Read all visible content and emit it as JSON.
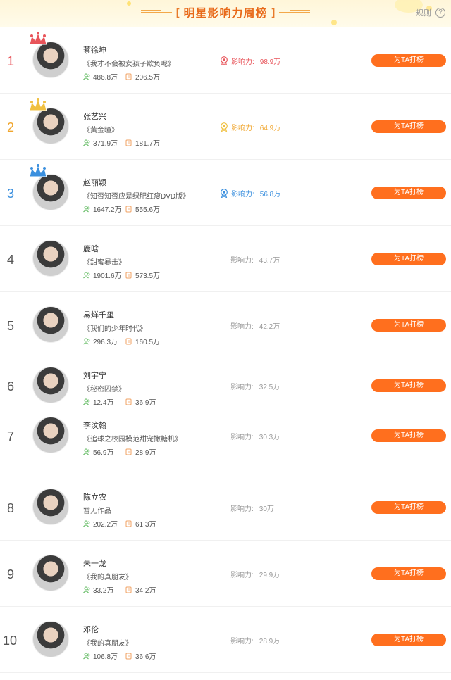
{
  "header": {
    "title": "明星影响力周榜",
    "bracket_left": "[",
    "bracket_right": "]",
    "rule_label": "规则",
    "rule_icon": "question-circle-icon"
  },
  "influence_label": "影响力:",
  "vote_label": "为TA打榜",
  "colors": {
    "accent": "#ff6f1e",
    "rank1": "#e8545a",
    "rank2": "#f0a52c",
    "rank3": "#3a8fde",
    "fans_icon": "#5cb85c",
    "works_icon": "#f0a060"
  },
  "stars": [
    {
      "rank": "1",
      "name": "蔡徐坤",
      "work": "《我才不会被女孩子欺负呢》",
      "fans": "486.8万",
      "count": "206.5万",
      "influence": "98.9万"
    },
    {
      "rank": "2",
      "name": "张艺兴",
      "work": "《黄金瞳》",
      "fans": "371.9万",
      "count": "181.7万",
      "influence": "64.9万"
    },
    {
      "rank": "3",
      "name": "赵丽颖",
      "work": "《知否知否应是绿肥红瘦DVD版》",
      "fans": "1647.2万",
      "count": "555.6万",
      "influence": "56.8万"
    },
    {
      "rank": "4",
      "name": "鹿晗",
      "work": "《甜蜜暴击》",
      "fans": "1901.6万",
      "count": "573.5万",
      "influence": "43.7万"
    },
    {
      "rank": "5",
      "name": "易烊千玺",
      "work": "《我们的少年时代》",
      "fans": "296.3万",
      "count": "160.5万",
      "influence": "42.2万"
    },
    {
      "rank": "6",
      "name": "刘宇宁",
      "work": "《秘密囚禁》",
      "fans": "12.4万",
      "count": "36.9万",
      "influence": "32.5万"
    },
    {
      "rank": "7",
      "name": "李汶翰",
      "work": "《追球之校园模范甜宠撒糖机》",
      "fans": "56.9万",
      "count": "28.9万",
      "influence": "30.3万"
    },
    {
      "rank": "8",
      "name": "陈立农",
      "work": "暂无作品",
      "fans": "202.2万",
      "count": "61.3万",
      "influence": "30万"
    },
    {
      "rank": "9",
      "name": "朱一龙",
      "work": "《我的真朋友》",
      "fans": "33.2万",
      "count": "34.2万",
      "influence": "29.9万"
    },
    {
      "rank": "10",
      "name": "邓伦",
      "work": "《我的真朋友》",
      "fans": "106.8万",
      "count": "36.6万",
      "influence": "28.9万"
    }
  ]
}
